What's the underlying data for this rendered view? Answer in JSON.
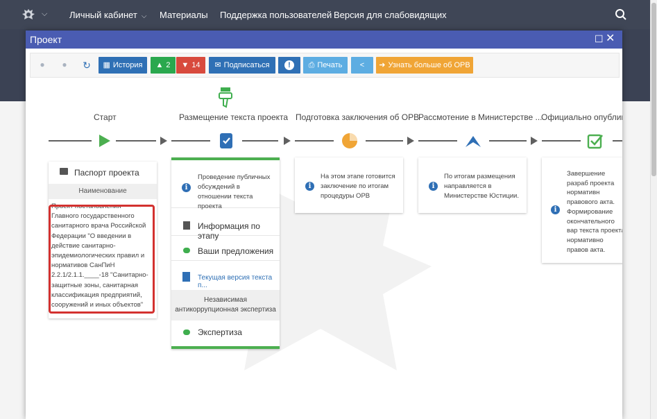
{
  "topbar": {
    "nav": [
      "Личный кабинет",
      "Материалы",
      "Поддержка пользователей",
      "Версия для слабовидящих"
    ]
  },
  "modal": {
    "title": "Проект",
    "toolbar": {
      "history_label": "История",
      "likes": "2",
      "dislikes": "14",
      "subscribe_label": "Подписаться",
      "print_label": "Печать",
      "learn_more_label": "Узнать больше об ОРВ"
    }
  },
  "stages": [
    "Старт",
    "Размещение текста проекта",
    "Подготовка заключения об ОРВ",
    "Рассмотение в Министерстве ...",
    "Официально опубликов"
  ],
  "start_card": {
    "passport_label": "Паспорт проекта",
    "name_header": "Наименование",
    "project_name": "Проект постановления Главного государственного санитарного врача Российской Федерации \"О введении в действие санитарно-эпидемиологических правил и нормативов СанПиН 2.2.1/2.1.1.____-18 \"Санитарно-защитные зоны, санитарная классификация предприятий, сооружений и иных объектов\""
  },
  "placement_card": {
    "description": "Проведение публичных обсуждений в отношении текста проекта",
    "info_label": "Информация по этапу",
    "proposals_label": "Ваши предложения",
    "current_version_label": "Текущая версия текста п...",
    "anticorruption_header": "Независимая антикоррупционная экспертиза",
    "expertise_label": "Экспертиза"
  },
  "orv_card": {
    "description": "На этом этапе готовится заключение по итогам процедуры ОРВ"
  },
  "ministry_card": {
    "description": "По итогам размещения направляется в Министерстве Юстиции."
  },
  "publish_card": {
    "description": "Завершение разраб проекта нормативн правового акта. Формирование окончательного вар текста проекта нормативно правов акта."
  },
  "colors": {
    "topbar": "#3f4656",
    "modal_header": "#4a5cb2",
    "btn_blue": "#2f70b5",
    "btn_green": "#2aa84e",
    "btn_red": "#d84a3d",
    "btn_light_blue": "#5dade2",
    "btn_orange": "#f0a536",
    "highlight_red": "#d3312f",
    "stage_green": "#4caf50"
  }
}
